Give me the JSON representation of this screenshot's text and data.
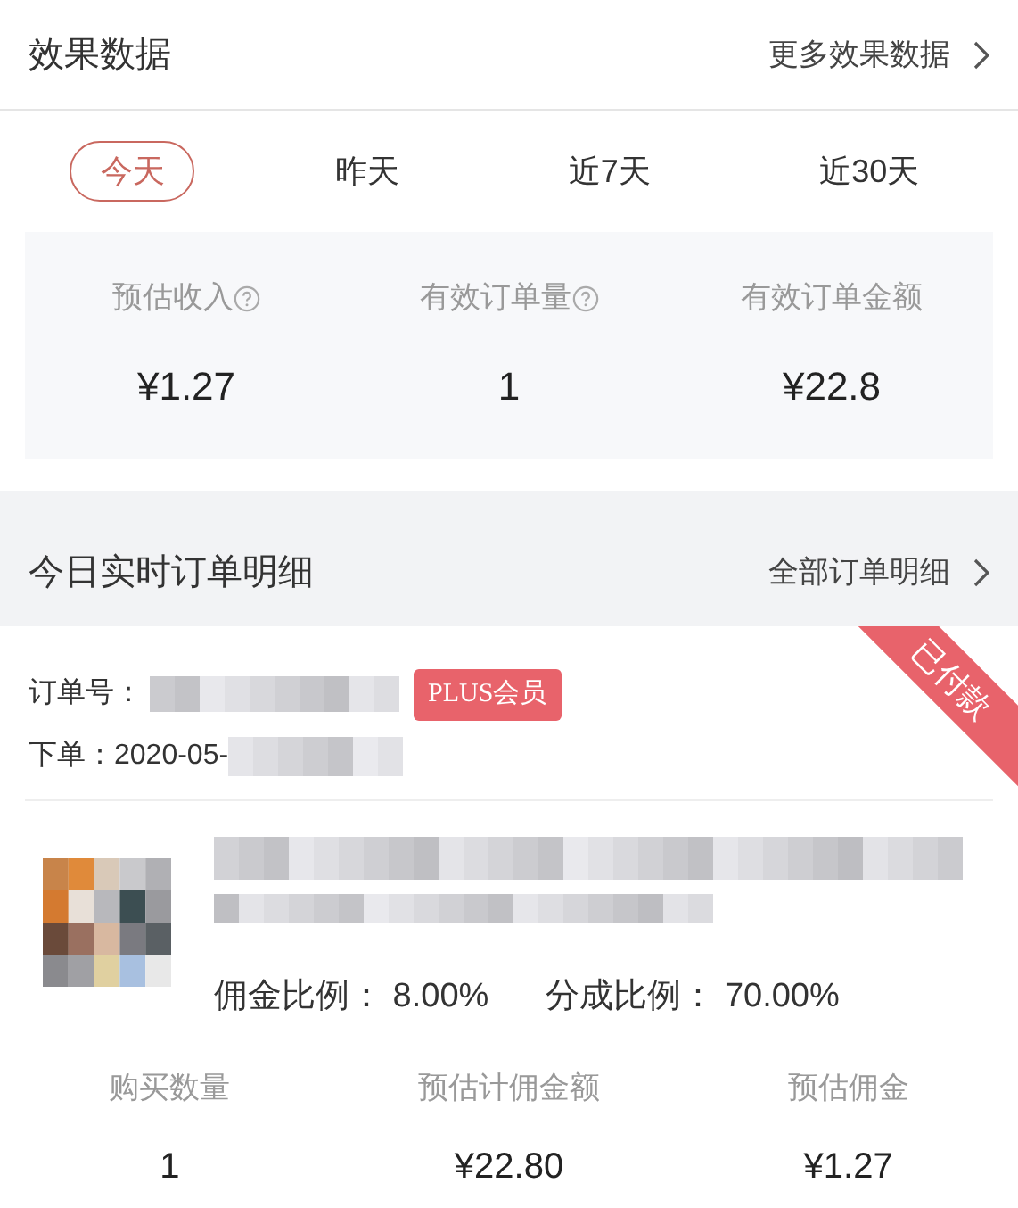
{
  "header": {
    "title": "效果数据",
    "link": "更多效果数据"
  },
  "tabs": [
    {
      "label": "今天",
      "selected": true
    },
    {
      "label": "昨天",
      "selected": false
    },
    {
      "label": "近7天",
      "selected": false
    },
    {
      "label": "近30天",
      "selected": false
    }
  ],
  "stats": [
    {
      "label": "预估收入",
      "help": true,
      "value": "¥1.27"
    },
    {
      "label": "有效订单量",
      "help": true,
      "value": "1"
    },
    {
      "label": "有效订单金额",
      "help": false,
      "value": "¥22.8"
    }
  ],
  "orders_section": {
    "title": "今日实时订单明细",
    "link": "全部订单明细"
  },
  "order": {
    "status": "已付款",
    "number_label": "订单号：",
    "badge": "PLUS会员",
    "date_label": "下单：",
    "date": "2020-05-",
    "commission_rate_label": "佣金比例：",
    "commission_rate": "8.00%",
    "share_rate_label": "分成比例：",
    "share_rate": "70.00%",
    "figures": [
      {
        "label": "购买数量",
        "value": "1"
      },
      {
        "label": "预估计佣金额",
        "value": "¥22.80"
      },
      {
        "label": "预估佣金",
        "value": "¥1.27"
      }
    ]
  }
}
